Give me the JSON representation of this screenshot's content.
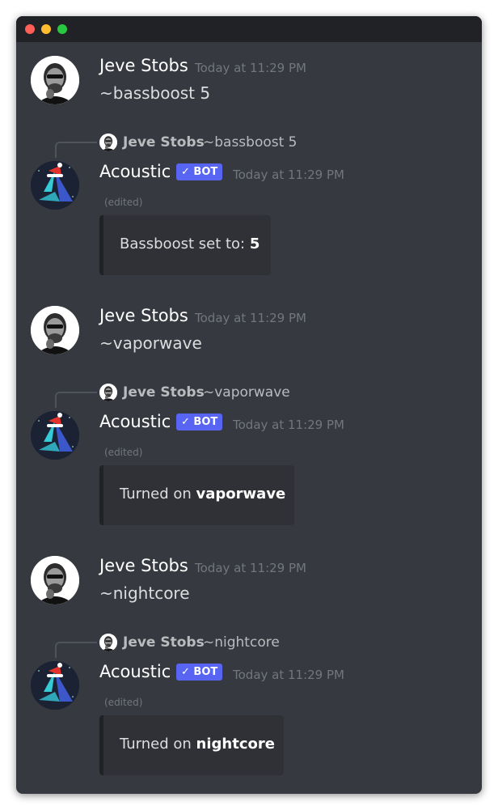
{
  "window": {
    "controls": [
      "close",
      "minimize",
      "maximize"
    ]
  },
  "messages": [
    {
      "user": {
        "name": "Jeve Stobs",
        "time": "Today at 11:29 PM",
        "text": "~bassboost 5"
      },
      "bot": {
        "reply_name": "Jeve Stobs",
        "reply_text": "~bassboost 5",
        "name": "Acoustic",
        "badge": "BOT",
        "time": "Today at 11:29 PM",
        "edited": "(edited)",
        "embed_prefix": "Bassboost set to: ",
        "embed_bold": "5"
      }
    },
    {
      "user": {
        "name": "Jeve Stobs",
        "time": "Today at 11:29 PM",
        "text": "~vaporwave"
      },
      "bot": {
        "reply_name": "Jeve Stobs",
        "reply_text": "~vaporwave",
        "name": "Acoustic",
        "badge": "BOT",
        "time": "Today at 11:29 PM",
        "edited": "(edited)",
        "embed_prefix": "Turned on ",
        "embed_bold": "vaporwave"
      }
    },
    {
      "user": {
        "name": "Jeve Stobs",
        "time": "Today at 11:29 PM",
        "text": "~nightcore"
      },
      "bot": {
        "reply_name": "Jeve Stobs",
        "reply_text": "~nightcore",
        "name": "Acoustic",
        "badge": "BOT",
        "time": "Today at 11:29 PM",
        "edited": "(edited)",
        "embed_prefix": "Turned on ",
        "embed_bold": "nightcore"
      }
    }
  ],
  "colors": {
    "background": "#36393f",
    "titlebar": "#202225",
    "bot_badge": "#5865f2",
    "embed_bg": "#2f3136",
    "timestamp": "#72767d"
  }
}
